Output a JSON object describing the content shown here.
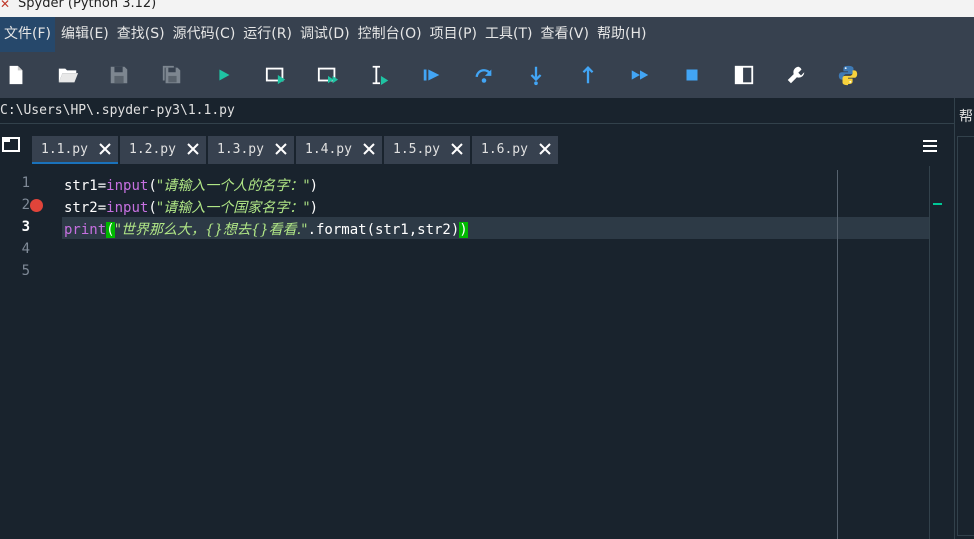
{
  "window": {
    "title": "Spyder (Python 3.12)"
  },
  "menubar": [
    {
      "label": "文件(F)"
    },
    {
      "label": "编辑(E)"
    },
    {
      "label": "查找(S)"
    },
    {
      "label": "源代码(C)"
    },
    {
      "label": "运行(R)"
    },
    {
      "label": "调试(D)"
    },
    {
      "label": "控制台(O)"
    },
    {
      "label": "项目(P)"
    },
    {
      "label": "工具(T)"
    },
    {
      "label": "查看(V)"
    },
    {
      "label": "帮助(H)"
    }
  ],
  "toolbar": [
    {
      "icon": "new-file-icon"
    },
    {
      "icon": "open-file-icon"
    },
    {
      "icon": "save-icon"
    },
    {
      "icon": "save-all-icon"
    },
    {
      "icon": "run-icon"
    },
    {
      "icon": "run-cell-icon"
    },
    {
      "icon": "run-cell-advance-icon"
    },
    {
      "icon": "run-selection-icon"
    },
    {
      "icon": "debug-icon"
    },
    {
      "icon": "step-over-icon"
    },
    {
      "icon": "step-into-icon"
    },
    {
      "icon": "step-return-icon"
    },
    {
      "icon": "continue-icon"
    },
    {
      "icon": "stop-icon"
    },
    {
      "icon": "maximize-pane-icon"
    },
    {
      "icon": "preferences-icon"
    },
    {
      "icon": "python-path-icon"
    }
  ],
  "path": "C:\\Users\\HP\\.spyder-py3\\1.1.py",
  "right_dock": {
    "tab_label": "帮"
  },
  "tabs": [
    {
      "label": "1.1.py",
      "active": true
    },
    {
      "label": "1.2.py",
      "active": false
    },
    {
      "label": "1.3.py",
      "active": false
    },
    {
      "label": "1.4.py",
      "active": false
    },
    {
      "label": "1.5.py",
      "active": false
    },
    {
      "label": "1.6.py",
      "active": false
    }
  ],
  "editor": {
    "current_line": 3,
    "breakpoint_lines": [
      2
    ],
    "line_numbers": [
      "1",
      "2",
      "3",
      "4",
      "5"
    ],
    "lines": [
      {
        "a": "str1=",
        "b": "input",
        "c": "(",
        "d": "\"请输入一个人的名字：\"",
        "e": ")"
      },
      {
        "a": "str2=",
        "b": "input",
        "c": "(",
        "d": "\"请输入一个国家名字：\"",
        "e": ")"
      },
      {
        "a": "print",
        "b": "(",
        "c": "\"世界那么大，{}想去{}看看.\"",
        "d": ".format(str1,str2)",
        "e": ")"
      }
    ]
  },
  "colors": {
    "background": "#19232d",
    "toolbar": "#37414f",
    "keyword": "#c670e0",
    "string": "#b0e686",
    "breakpoint": "#e0443a",
    "bracket_match": "#00b800",
    "tab_accent": "#1a72bb"
  }
}
